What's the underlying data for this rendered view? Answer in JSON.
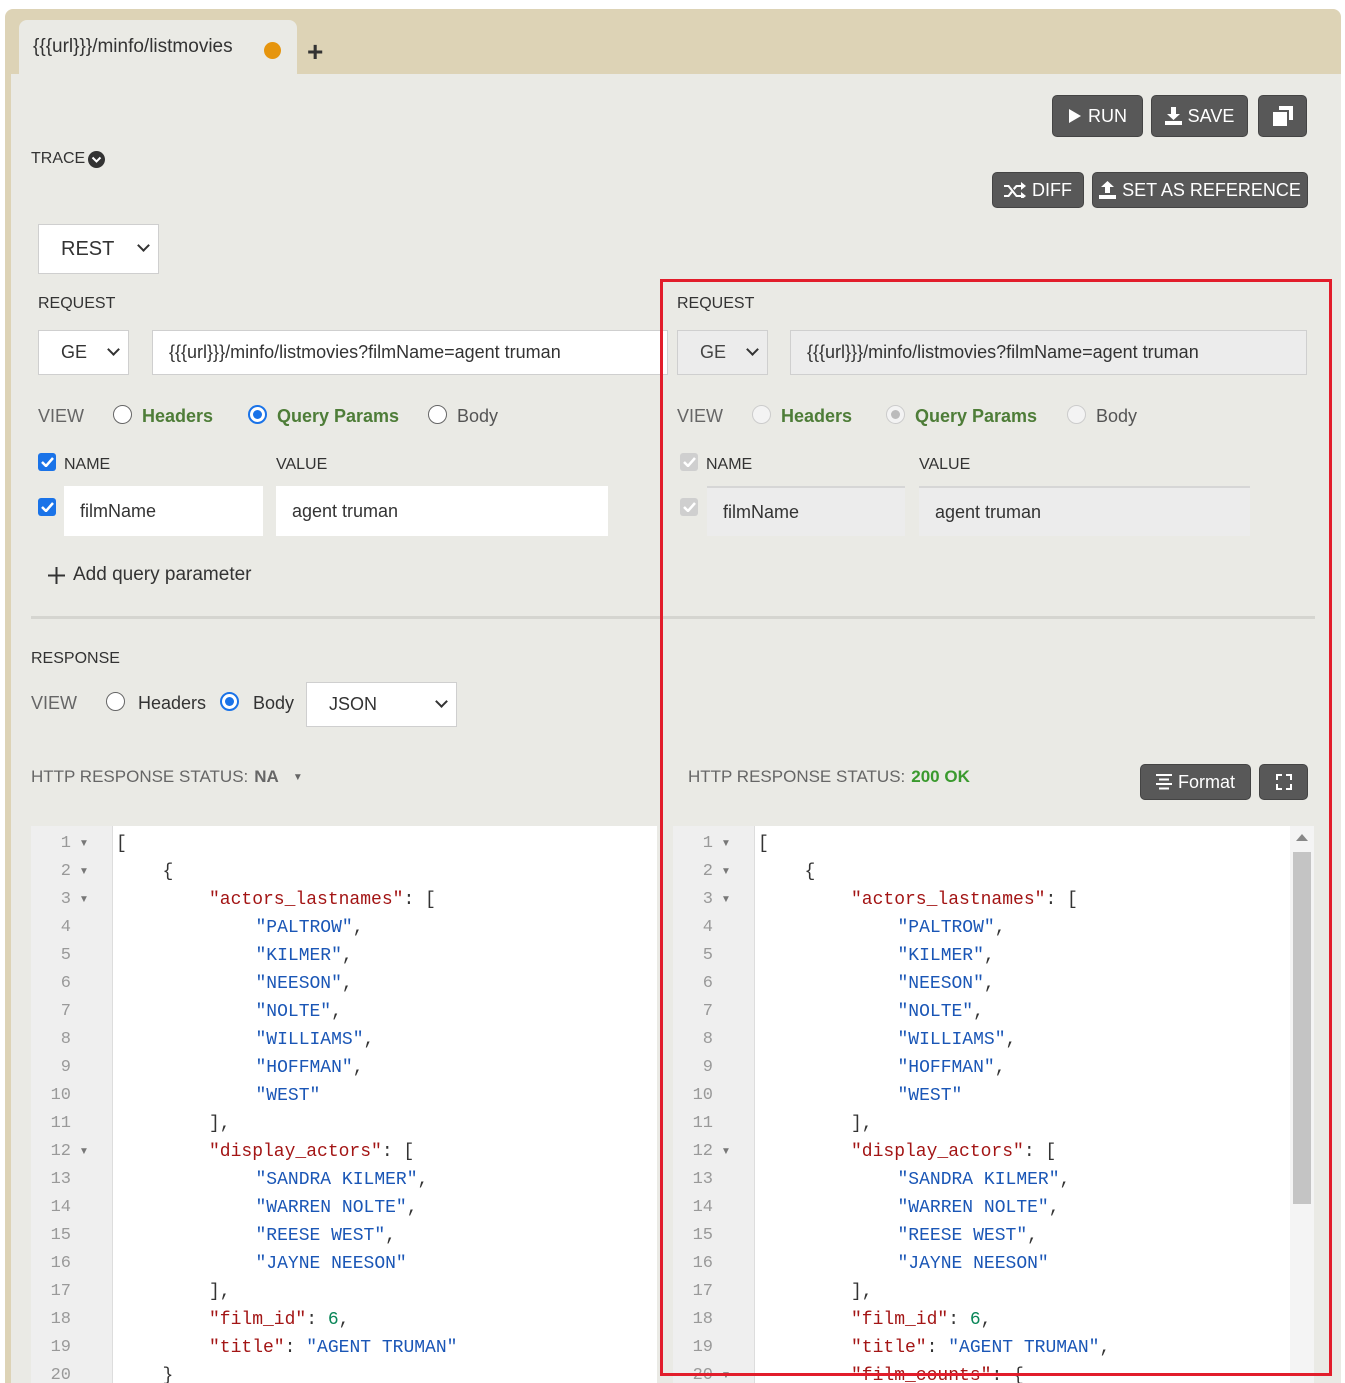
{
  "tab": {
    "title": "{{{url}}}/minfo/listmovies",
    "add_icon": "plus-icon"
  },
  "toolbar": {
    "run": "RUN",
    "save": "SAVE",
    "diff": "DIFF",
    "set_reference": "SET AS REFERENCE"
  },
  "trace": {
    "label": "TRACE"
  },
  "protocol": {
    "value": "REST"
  },
  "left": {
    "request_label": "REQUEST",
    "method": "GE",
    "url": "{{{url}}}/minfo/listmovies?filmName=agent truman",
    "view_label": "VIEW",
    "view_options": [
      "Headers",
      "Query Params",
      "Body"
    ],
    "name_header": "NAME",
    "value_header": "VALUE",
    "param_name": "filmName",
    "param_value": "agent truman",
    "add_param": "Add query parameter"
  },
  "right": {
    "request_label": "REQUEST",
    "method": "GE",
    "url": "{{{url}}}/minfo/listmovies?filmName=agent truman",
    "view_label": "VIEW",
    "view_options": [
      "Headers",
      "Query Params",
      "Body"
    ],
    "name_header": "NAME",
    "value_header": "VALUE",
    "param_name": "filmName",
    "param_value": "agent truman"
  },
  "response": {
    "label": "RESPONSE",
    "view_label": "VIEW",
    "view_options": [
      "Headers",
      "Body"
    ],
    "format": "JSON",
    "status_label_left": "HTTP RESPONSE STATUS:",
    "status_value_left": "NA",
    "status_label_right": "HTTP RESPONSE STATUS:",
    "status_value_right": "200 OK",
    "format_button": "Format"
  },
  "editor_left": {
    "lines": [
      {
        "n": "1",
        "fold": true,
        "indent": 0,
        "parts": [
          [
            "p",
            "["
          ]
        ]
      },
      {
        "n": "2",
        "fold": true,
        "indent": 1,
        "parts": [
          [
            "p",
            "{"
          ]
        ]
      },
      {
        "n": "3",
        "fold": true,
        "indent": 2,
        "parts": [
          [
            "k",
            "\"actors_lastnames\""
          ],
          [
            "p",
            ": ["
          ]
        ]
      },
      {
        "n": "4",
        "fold": false,
        "indent": 3,
        "parts": [
          [
            "s",
            "\"PALTROW\""
          ],
          [
            "p",
            ","
          ]
        ]
      },
      {
        "n": "5",
        "fold": false,
        "indent": 3,
        "parts": [
          [
            "s",
            "\"KILMER\""
          ],
          [
            "p",
            ","
          ]
        ]
      },
      {
        "n": "6",
        "fold": false,
        "indent": 3,
        "parts": [
          [
            "s",
            "\"NEESON\""
          ],
          [
            "p",
            ","
          ]
        ]
      },
      {
        "n": "7",
        "fold": false,
        "indent": 3,
        "parts": [
          [
            "s",
            "\"NOLTE\""
          ],
          [
            "p",
            ","
          ]
        ]
      },
      {
        "n": "8",
        "fold": false,
        "indent": 3,
        "parts": [
          [
            "s",
            "\"WILLIAMS\""
          ],
          [
            "p",
            ","
          ]
        ]
      },
      {
        "n": "9",
        "fold": false,
        "indent": 3,
        "parts": [
          [
            "s",
            "\"HOFFMAN\""
          ],
          [
            "p",
            ","
          ]
        ]
      },
      {
        "n": "10",
        "fold": false,
        "indent": 3,
        "parts": [
          [
            "s",
            "\"WEST\""
          ]
        ]
      },
      {
        "n": "11",
        "fold": false,
        "indent": 2,
        "parts": [
          [
            "p",
            "],"
          ]
        ]
      },
      {
        "n": "12",
        "fold": true,
        "indent": 2,
        "parts": [
          [
            "k",
            "\"display_actors\""
          ],
          [
            "p",
            ": ["
          ]
        ]
      },
      {
        "n": "13",
        "fold": false,
        "indent": 3,
        "parts": [
          [
            "s",
            "\"SANDRA KILMER\""
          ],
          [
            "p",
            ","
          ]
        ]
      },
      {
        "n": "14",
        "fold": false,
        "indent": 3,
        "parts": [
          [
            "s",
            "\"WARREN NOLTE\""
          ],
          [
            "p",
            ","
          ]
        ]
      },
      {
        "n": "15",
        "fold": false,
        "indent": 3,
        "parts": [
          [
            "s",
            "\"REESE WEST\""
          ],
          [
            "p",
            ","
          ]
        ]
      },
      {
        "n": "16",
        "fold": false,
        "indent": 3,
        "parts": [
          [
            "s",
            "\"JAYNE NEESON\""
          ]
        ]
      },
      {
        "n": "17",
        "fold": false,
        "indent": 2,
        "parts": [
          [
            "p",
            "],"
          ]
        ]
      },
      {
        "n": "18",
        "fold": false,
        "indent": 2,
        "parts": [
          [
            "k",
            "\"film_id\""
          ],
          [
            "p",
            ": "
          ],
          [
            "n",
            "6"
          ],
          [
            "p",
            ","
          ]
        ]
      },
      {
        "n": "19",
        "fold": false,
        "indent": 2,
        "parts": [
          [
            "k",
            "\"title\""
          ],
          [
            "p",
            ": "
          ],
          [
            "s",
            "\"AGENT TRUMAN\""
          ]
        ]
      },
      {
        "n": "20",
        "fold": false,
        "indent": 1,
        "parts": [
          [
            "p",
            "}"
          ]
        ]
      }
    ]
  },
  "editor_right": {
    "lines": [
      {
        "n": "1",
        "fold": true,
        "indent": 0,
        "parts": [
          [
            "p",
            "["
          ]
        ]
      },
      {
        "n": "2",
        "fold": true,
        "indent": 1,
        "parts": [
          [
            "p",
            "{"
          ]
        ]
      },
      {
        "n": "3",
        "fold": true,
        "indent": 2,
        "parts": [
          [
            "k",
            "\"actors_lastnames\""
          ],
          [
            "p",
            ": ["
          ]
        ]
      },
      {
        "n": "4",
        "fold": false,
        "indent": 3,
        "parts": [
          [
            "s",
            "\"PALTROW\""
          ],
          [
            "p",
            ","
          ]
        ]
      },
      {
        "n": "5",
        "fold": false,
        "indent": 3,
        "parts": [
          [
            "s",
            "\"KILMER\""
          ],
          [
            "p",
            ","
          ]
        ]
      },
      {
        "n": "6",
        "fold": false,
        "indent": 3,
        "parts": [
          [
            "s",
            "\"NEESON\""
          ],
          [
            "p",
            ","
          ]
        ]
      },
      {
        "n": "7",
        "fold": false,
        "indent": 3,
        "parts": [
          [
            "s",
            "\"NOLTE\""
          ],
          [
            "p",
            ","
          ]
        ]
      },
      {
        "n": "8",
        "fold": false,
        "indent": 3,
        "parts": [
          [
            "s",
            "\"WILLIAMS\""
          ],
          [
            "p",
            ","
          ]
        ]
      },
      {
        "n": "9",
        "fold": false,
        "indent": 3,
        "parts": [
          [
            "s",
            "\"HOFFMAN\""
          ],
          [
            "p",
            ","
          ]
        ]
      },
      {
        "n": "10",
        "fold": false,
        "indent": 3,
        "parts": [
          [
            "s",
            "\"WEST\""
          ]
        ]
      },
      {
        "n": "11",
        "fold": false,
        "indent": 2,
        "parts": [
          [
            "p",
            "],"
          ]
        ]
      },
      {
        "n": "12",
        "fold": true,
        "indent": 2,
        "parts": [
          [
            "k",
            "\"display_actors\""
          ],
          [
            "p",
            ": ["
          ]
        ]
      },
      {
        "n": "13",
        "fold": false,
        "indent": 3,
        "parts": [
          [
            "s",
            "\"SANDRA KILMER\""
          ],
          [
            "p",
            ","
          ]
        ]
      },
      {
        "n": "14",
        "fold": false,
        "indent": 3,
        "parts": [
          [
            "s",
            "\"WARREN NOLTE\""
          ],
          [
            "p",
            ","
          ]
        ]
      },
      {
        "n": "15",
        "fold": false,
        "indent": 3,
        "parts": [
          [
            "s",
            "\"REESE WEST\""
          ],
          [
            "p",
            ","
          ]
        ]
      },
      {
        "n": "16",
        "fold": false,
        "indent": 3,
        "parts": [
          [
            "s",
            "\"JAYNE NEESON\""
          ]
        ]
      },
      {
        "n": "17",
        "fold": false,
        "indent": 2,
        "parts": [
          [
            "p",
            "],"
          ]
        ]
      },
      {
        "n": "18",
        "fold": false,
        "indent": 2,
        "parts": [
          [
            "k",
            "\"film_id\""
          ],
          [
            "p",
            ": "
          ],
          [
            "n",
            "6"
          ],
          [
            "p",
            ","
          ]
        ]
      },
      {
        "n": "19",
        "fold": false,
        "indent": 2,
        "parts": [
          [
            "k",
            "\"title\""
          ],
          [
            "p",
            ": "
          ],
          [
            "s",
            "\"AGENT TRUMAN\""
          ],
          [
            "p",
            ","
          ]
        ]
      },
      {
        "n": "20",
        "fold": true,
        "indent": 2,
        "parts": [
          [
            "k",
            "\"film_counts\""
          ],
          [
            "p",
            ": {"
          ]
        ]
      }
    ]
  },
  "colors": {
    "accent_blue": "#1a73e8",
    "highlight_red": "#e21d2b",
    "status_ok": "#3a9a2e",
    "tab_dot": "#e6950e"
  }
}
